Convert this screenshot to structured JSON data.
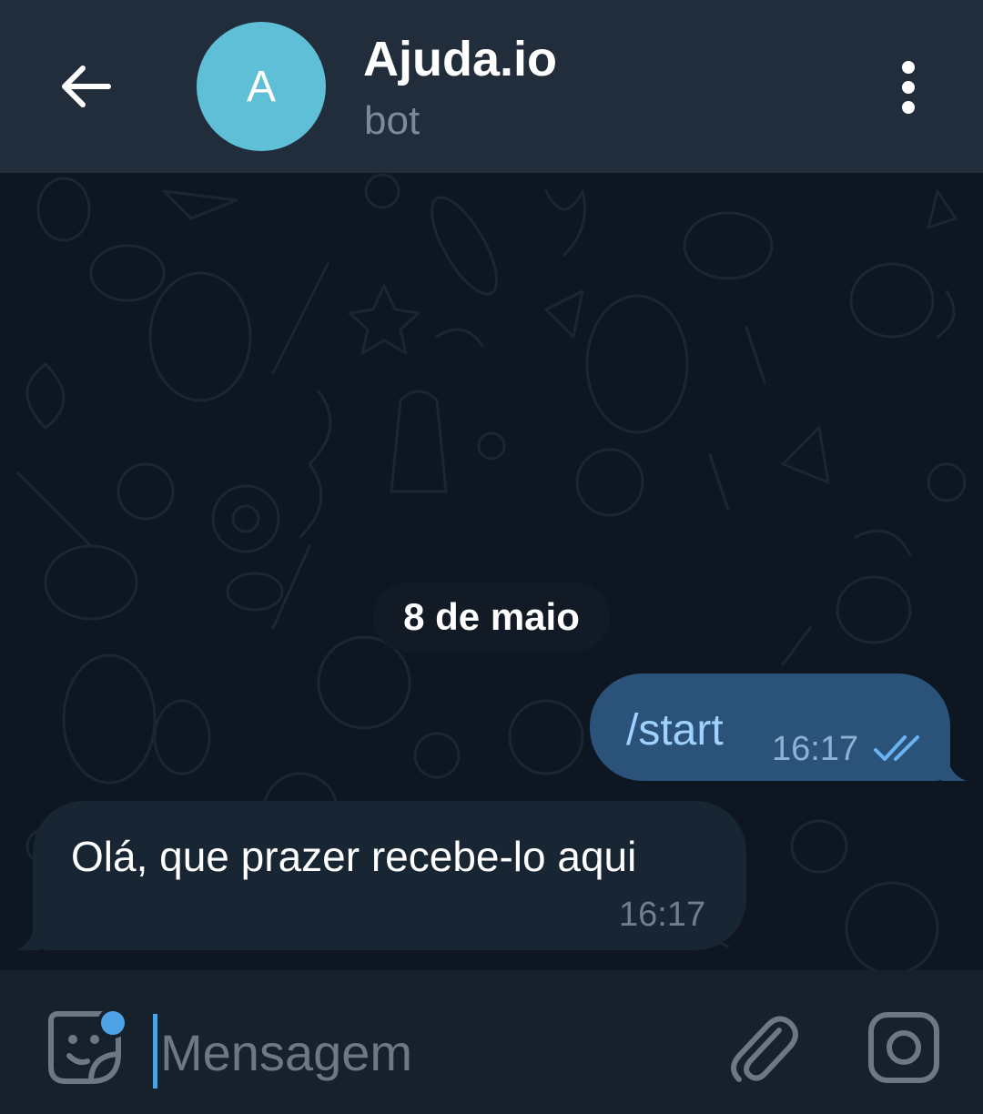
{
  "header": {
    "back_icon": "arrow-left-icon",
    "avatar_letter": "A",
    "avatar_color": "#5fbfd6",
    "title": "Ajuda.io",
    "subtitle": "bot",
    "menu_icon": "more-vertical-icon"
  },
  "chat": {
    "date_separator": "8 de maio",
    "messages": [
      {
        "direction": "outgoing",
        "text": "/start",
        "time": "16:17",
        "status_icon": "double-check-icon"
      },
      {
        "direction": "incoming",
        "text": "Olá, que prazer recebe-lo aqui",
        "time": "16:17"
      }
    ]
  },
  "composer": {
    "sticker_icon": "sticker-icon",
    "placeholder": "Mensagem",
    "value": "",
    "attach_icon": "paperclip-icon",
    "camera_icon": "camera-icon"
  },
  "colors": {
    "header_bg": "#212d3b",
    "chat_bg": "#0e1621",
    "outgoing_bubble": "#2b5278",
    "incoming_bubble": "#182533",
    "accent": "#4da2e6"
  }
}
